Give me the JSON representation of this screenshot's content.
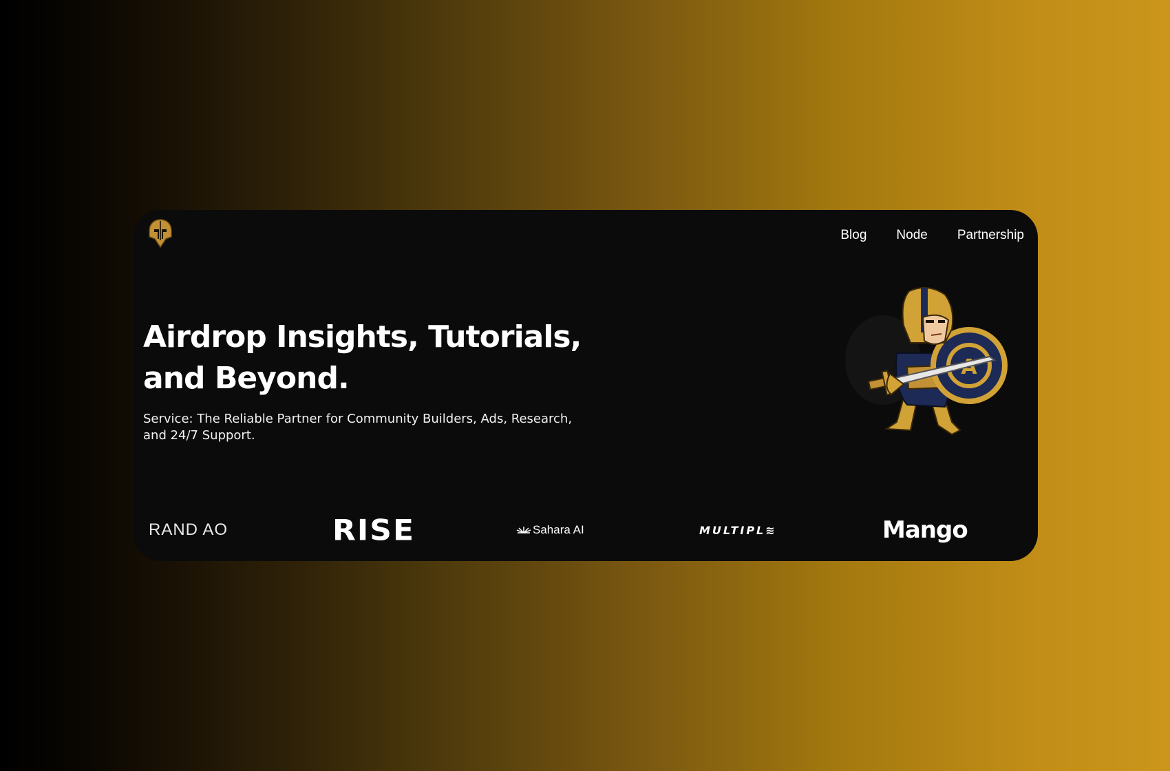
{
  "nav": {
    "items": [
      {
        "label": "Blog"
      },
      {
        "label": "Node"
      },
      {
        "label": "Partnership"
      }
    ]
  },
  "hero": {
    "title": "Airdrop Insights, Tutorials, and Beyond.",
    "subtitle": "Service: The Reliable Partner for Community Builders, Ads, Research, and 24/7 Support."
  },
  "partners": [
    {
      "name": "RAND AO"
    },
    {
      "name": "RISE"
    },
    {
      "name": "Sahara AI",
      "icon": "sahara-sunburst-icon"
    },
    {
      "name": "MULTIPL≋"
    },
    {
      "name": "Mango"
    }
  ],
  "colors": {
    "card_bg": "#0b0b0b",
    "gold": "#d1a236",
    "navy": "#1d2a55",
    "gradient_start": "#000000",
    "gradient_end": "#cb961b"
  },
  "icons": {
    "logo": "spartan-helmet-icon",
    "mascot": "knight-mascot-illustration"
  }
}
